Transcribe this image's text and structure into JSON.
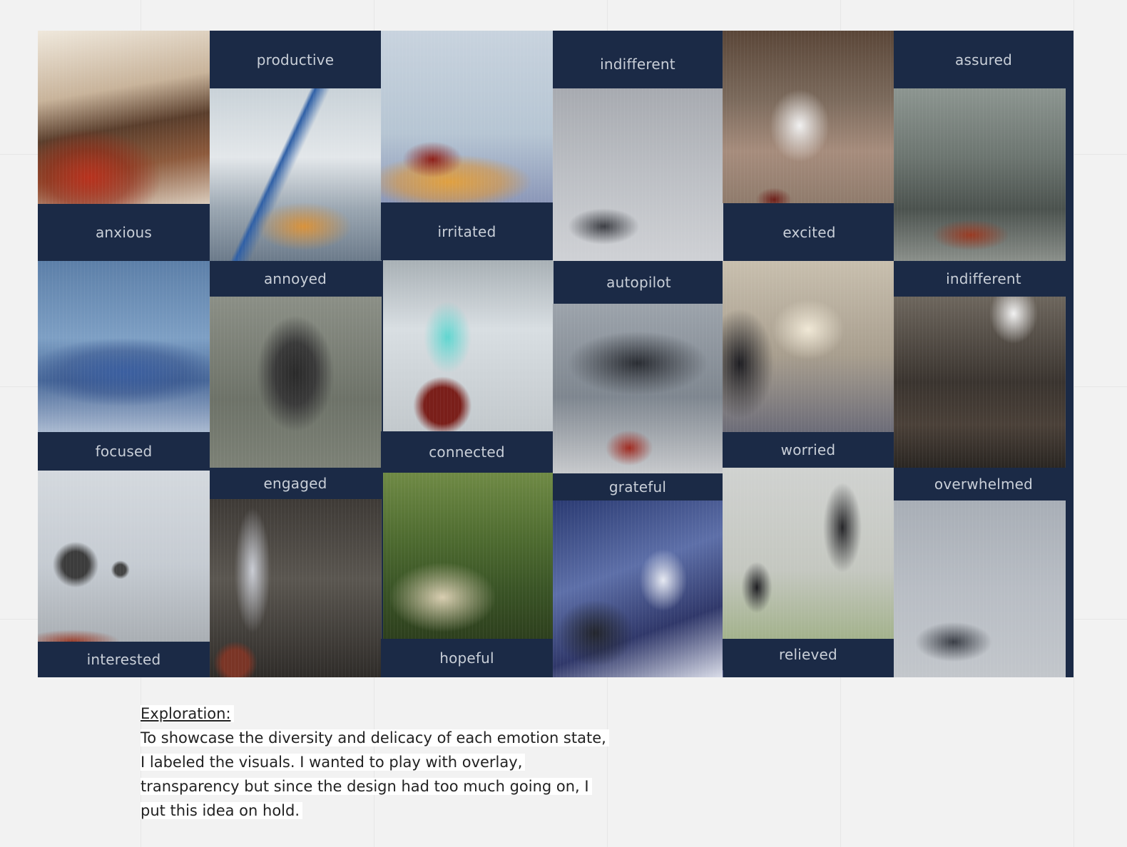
{
  "board": {
    "labels": {
      "productive": "productive",
      "indifferent_top": "indifferent",
      "assured": "assured",
      "anxious": "anxious",
      "irritated": "irritated",
      "excited": "excited",
      "annoyed": "annoyed",
      "autopilot": "autopilot",
      "indifferent_right": "indifferent",
      "focused": "focused",
      "connected": "connected",
      "worried": "worried",
      "engaged": "engaged",
      "grateful": "grateful",
      "overwhelmed": "overwhelmed",
      "interested": "interested",
      "hopeful": "hopeful",
      "relieved": "relieved"
    }
  },
  "note": {
    "heading": "Exploration:",
    "lines": [
      "To showcase the diversity and delicacy of each emotion state,",
      "I labeled the visuals. I wanted to play with overlay,",
      "transparency but since the design had too much going on, I",
      "put this idea on hold."
    ]
  }
}
